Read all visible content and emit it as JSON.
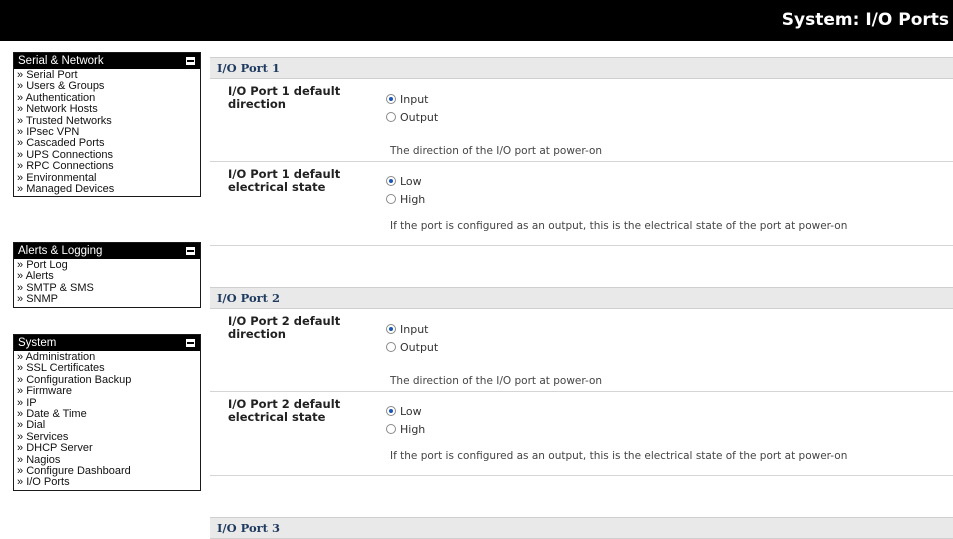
{
  "page_title": "System: I/O Ports",
  "sidebar": {
    "groups": [
      {
        "title": "Serial & Network",
        "items": [
          "Serial Port",
          "Users & Groups",
          "Authentication",
          "Network Hosts",
          "Trusted Networks",
          "IPsec VPN",
          "Cascaded Ports",
          "UPS Connections",
          "RPC Connections",
          "Environmental",
          "Managed Devices"
        ]
      },
      {
        "title": "Alerts & Logging",
        "items": [
          "Port Log",
          "Alerts",
          "SMTP & SMS",
          "SNMP"
        ]
      },
      {
        "title": "System",
        "items": [
          "Administration",
          "SSL Certificates",
          "Configuration Backup",
          "Firmware",
          "IP",
          "Date & Time",
          "Dial",
          "Services",
          "DHCP Server",
          "Nagios",
          "Configure Dashboard",
          "I/O Ports"
        ]
      }
    ]
  },
  "sections": [
    {
      "title": "I/O Port 1",
      "direction": {
        "label": "I/O Port 1 default direction",
        "options": [
          {
            "label": "Input",
            "selected": true
          },
          {
            "label": "Output",
            "selected": false
          }
        ],
        "desc": "The direction of the I/O port at power-on"
      },
      "state": {
        "label": "I/O Port 1 default electrical state",
        "options": [
          {
            "label": "Low",
            "selected": true
          },
          {
            "label": "High",
            "selected": false
          }
        ],
        "desc": "If the port is configured as an output, this is the electrical state of the port at power-on"
      }
    },
    {
      "title": "I/O Port 2",
      "direction": {
        "label": "I/O Port 2 default direction",
        "options": [
          {
            "label": "Input",
            "selected": true
          },
          {
            "label": "Output",
            "selected": false
          }
        ],
        "desc": "The direction of the I/O port at power-on"
      },
      "state": {
        "label": "I/O Port 2 default electrical state",
        "options": [
          {
            "label": "Low",
            "selected": true
          },
          {
            "label": "High",
            "selected": false
          }
        ],
        "desc": "If the port is configured as an output, this is the electrical state of the port at power-on"
      }
    },
    {
      "title": "I/O Port 3"
    }
  ],
  "colors": {
    "header_bg": "#000000",
    "section_bg": "#e9e9e9",
    "section_title": "#1f3a5f",
    "radio_selected": "#1a58b5"
  }
}
